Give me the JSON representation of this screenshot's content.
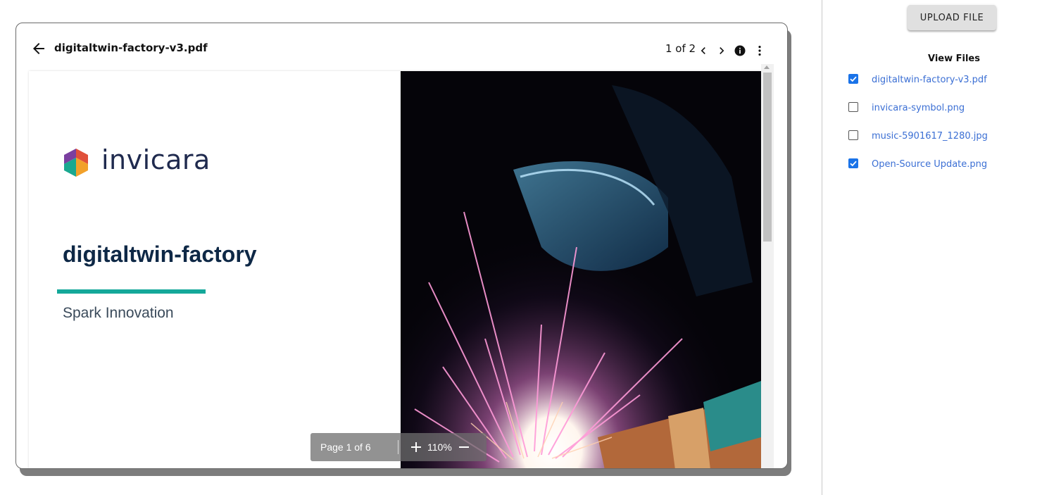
{
  "viewer": {
    "title": "digitaltwin-factory-v3.pdf",
    "page_count": "1 of 2"
  },
  "document": {
    "logo_text": "invicara",
    "heading": "digitaltwin-factory",
    "subtitle": "Spark Innovation"
  },
  "zoom_toolbar": {
    "page_label": "Page 1 of 6",
    "zoom_level": "110%"
  },
  "side_panel": {
    "upload_label": "UPLOAD FILE",
    "files_title": "View Files",
    "files": [
      {
        "name": "digitaltwin-factory-v3.pdf",
        "checked": true
      },
      {
        "name": "invicara-symbol.png",
        "checked": false
      },
      {
        "name": "music-5901617_1280.jpg",
        "checked": false
      },
      {
        "name": "Open-Source Update.png",
        "checked": true
      }
    ]
  },
  "colors": {
    "accent_teal": "#14a89a",
    "link_blue": "#3b6fd4",
    "checkbox_blue": "#1a73e8",
    "heading_navy": "#0e2846"
  }
}
